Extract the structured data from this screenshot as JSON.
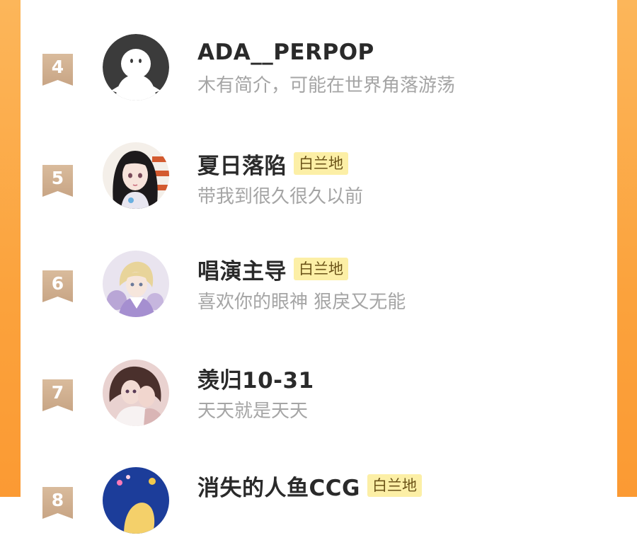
{
  "rankings": [
    {
      "rank": "4",
      "name": "ADA__PERPOP",
      "badge": "",
      "bio": "木有简介，可能在世界角落游荡",
      "avatar_icon": "default-ghost-avatar"
    },
    {
      "rank": "5",
      "name": "夏日落陷",
      "badge": "白兰地",
      "bio": "带我到很久很久以前",
      "avatar_icon": "anime-girl-avatar"
    },
    {
      "rank": "6",
      "name": "唱演主导",
      "badge": "白兰地",
      "bio": "喜欢你的眼神 狠戾又无能",
      "avatar_icon": "blonde-boy-avatar"
    },
    {
      "rank": "7",
      "name": "羡归10-31",
      "badge": "",
      "bio": "天天就是天天",
      "avatar_icon": "couple-avatar"
    },
    {
      "rank": "8",
      "name": "消失的人鱼CCG",
      "badge": "白兰地",
      "bio": "",
      "avatar_icon": "blue-night-avatar"
    }
  ],
  "colors": {
    "frame_orange": "#fba23c",
    "rank_ribbon": "#cfae8f",
    "badge_bg": "#fcefa6",
    "name_text": "#2a2a2a",
    "bio_text": "#a5a5a5"
  }
}
